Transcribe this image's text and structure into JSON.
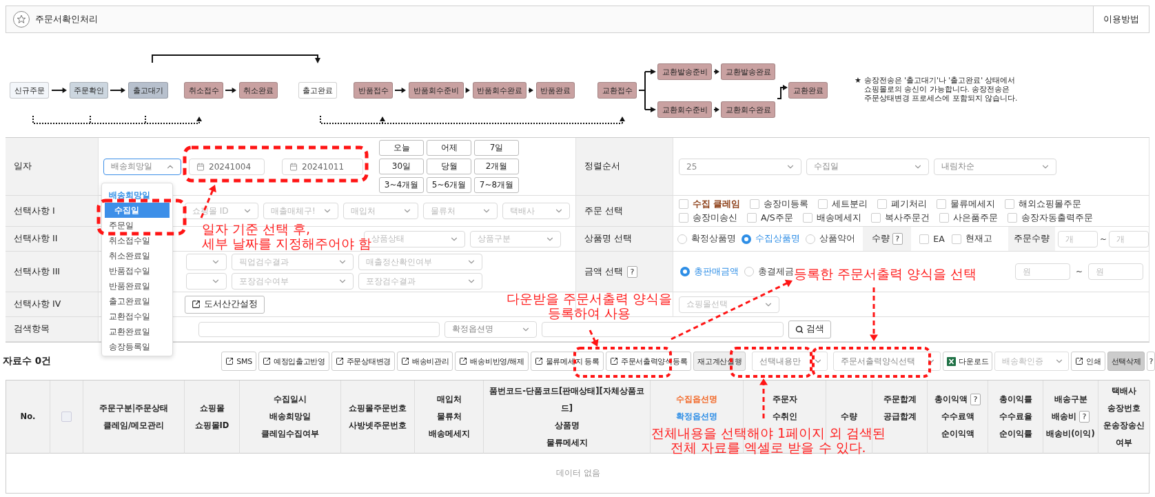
{
  "header": {
    "title": "주문서확인처리",
    "help_button": "이용방법"
  },
  "flow": {
    "nodes": [
      {
        "label": "신규주문",
        "color": "#f3f6fa"
      },
      {
        "label": "주문확인",
        "color": "#ccd6df"
      },
      {
        "label": "출고대기",
        "color": "#b7c0cd"
      },
      {
        "label": "취소접수",
        "color": "#c9a1a1"
      },
      {
        "label": "취소완료",
        "color": "#c9a1a1"
      },
      {
        "label": "출고완료",
        "color": "#ffffff"
      },
      {
        "label": "반품접수",
        "color": "#c9a1a1"
      },
      {
        "label": "반품회수준비",
        "color": "#c9a1a1"
      },
      {
        "label": "반품회수완료",
        "color": "#c9a1a1"
      },
      {
        "label": "반품완료",
        "color": "#c9a1a1"
      },
      {
        "label": "교환접수",
        "color": "#c9a1a1"
      },
      {
        "label": "교환발송준비",
        "color": "#c9a1a1"
      },
      {
        "label": "교환발송완료",
        "color": "#c9a1a1"
      },
      {
        "label": "교환회수준비",
        "color": "#c9a1a1"
      },
      {
        "label": "교환회수완료",
        "color": "#c9a1a1"
      },
      {
        "label": "교환완료",
        "color": "#c9a1a1"
      }
    ],
    "note_mark": "★",
    "note": "송장전송은 '출고대기'나 '출고완료' 상태에서\n쇼핑몰로의 송신이 가능합니다. 송장전송은\n주문상태변경 프로세스에 포함되지 않습니다."
  },
  "form": {
    "date": {
      "label": "일자",
      "basis": "배송희망일",
      "from": "20241004",
      "to": "20241011",
      "quick": [
        "오늘",
        "어제",
        "7일",
        "30일",
        "당월",
        "2개월",
        "3~4개월",
        "5~6개월",
        "7~8개월"
      ]
    },
    "sort": {
      "label": "정렬순서",
      "selects": [
        "25",
        "수집일",
        "내림차순"
      ]
    },
    "option1": {
      "label": "선택사항 I",
      "selects": [
        "쇼핑몰 ID",
        "매출매체구!",
        "매입처",
        "물류처",
        "택배사"
      ]
    },
    "order_select": {
      "label": "주문 선택",
      "options": [
        {
          "label": "수집 클레임",
          "checked": false,
          "kind": "claim"
        },
        {
          "label": "송장미등록",
          "checked": false,
          "kind": "plain"
        },
        {
          "label": "세트분리",
          "checked": false,
          "kind": "plain"
        },
        {
          "label": "폐기처리",
          "checked": false,
          "kind": "plain"
        },
        {
          "label": "물류메세지",
          "checked": false,
          "kind": "plain"
        },
        {
          "label": "해외쇼핑몰주문",
          "checked": false,
          "kind": "plain"
        },
        {
          "label": "송장미송신",
          "checked": false,
          "kind": "plain"
        },
        {
          "label": "A/S주문",
          "checked": false,
          "kind": "plain"
        },
        {
          "label": "배송메세지",
          "checked": false,
          "kind": "plain"
        },
        {
          "label": "복사주문건",
          "checked": false,
          "kind": "plain"
        },
        {
          "label": "사은품주문",
          "checked": false,
          "kind": "plain"
        },
        {
          "label": "송장자동출력주문",
          "checked": false,
          "kind": "plain"
        }
      ]
    },
    "option2": {
      "label": "선택사항 II",
      "selects": [
        "상품상태",
        "상품구분"
      ]
    },
    "product_name": {
      "label": "상품명 선택",
      "options": [
        {
          "label": "확정상품명",
          "selected": false
        },
        {
          "label": "수집상품명",
          "selected": true
        },
        {
          "label": "상품약어",
          "selected": false
        }
      ],
      "qty_label": "수량",
      "qty_help": "?",
      "checks": [
        {
          "label": "EA",
          "checked": false
        },
        {
          "label": "현재고",
          "checked": false
        }
      ],
      "order_qty_label": "주문수량",
      "from_placeholder": "개",
      "tilde": "~",
      "to_placeholder": "개"
    },
    "option3": {
      "label": "선택사항 III",
      "row1": [
        "픽업검수결과",
        "매출정산확인여부"
      ],
      "row2": [
        "포장검수여부",
        "포장검수결과"
      ]
    },
    "amount": {
      "label": "금액 선택",
      "help": "?",
      "options": [
        {
          "label": "총판매금액",
          "selected": true
        },
        {
          "label": "총결제금",
          "selected": false
        }
      ],
      "from_placeholder": "원",
      "tilde": "~",
      "to_placeholder": "원"
    },
    "option4": {
      "label": "선택사항 IV",
      "button": "도서산간설정",
      "mall_select": "쇼핑몰선택"
    },
    "search": {
      "label": "검색항목",
      "field_select": "확정옵션명",
      "button": "검색"
    }
  },
  "dropdown": {
    "items": [
      {
        "label": "배송희망일",
        "current": true,
        "selected": false
      },
      {
        "label": "수집일",
        "current": false,
        "selected": true
      },
      {
        "label": "주문일",
        "current": false,
        "selected": false
      },
      {
        "label": "취소접수일",
        "current": false,
        "selected": false
      },
      {
        "label": "취소완료일",
        "current": false,
        "selected": false
      },
      {
        "label": "반품접수일",
        "current": false,
        "selected": false
      },
      {
        "label": "반품완료일",
        "current": false,
        "selected": false
      },
      {
        "label": "출고완료일",
        "current": false,
        "selected": false
      },
      {
        "label": "교환접수일",
        "current": false,
        "selected": false
      },
      {
        "label": "교환완료일",
        "current": false,
        "selected": false
      },
      {
        "label": "송장등록일",
        "current": false,
        "selected": false
      }
    ]
  },
  "toolbar": {
    "count": "자료수 0건",
    "controls": [
      {
        "label": "SMS",
        "kind": "link"
      },
      {
        "label": "예정입출고반영",
        "kind": "link"
      },
      {
        "label": "주문상태변경",
        "kind": "link"
      },
      {
        "label": "배송비관리",
        "kind": "link"
      },
      {
        "label": "배송비반영/해제",
        "kind": "link"
      },
      {
        "label": "물류메세지 등록",
        "kind": "link"
      },
      {
        "label": "주문서출력양식등록",
        "kind": "link"
      },
      {
        "label": "재고계산실행",
        "kind": "gray"
      },
      {
        "label": "선택내용만",
        "kind": "select"
      },
      {
        "label": "주문서출력양식선택",
        "kind": "select"
      },
      {
        "label": "다운로드",
        "kind": "excel"
      },
      {
        "label": "배송확인증",
        "kind": "disabled_select"
      },
      {
        "label": "인쇄",
        "kind": "link"
      },
      {
        "label": "선택삭제",
        "kind": "dark"
      },
      {
        "label": "?",
        "kind": "help"
      }
    ]
  },
  "table": {
    "columns": [
      {
        "kind": "text",
        "lines": [
          {
            "text": "No."
          }
        ]
      },
      {
        "kind": "checkbox",
        "checked": false
      },
      {
        "kind": "text",
        "lines": [
          {
            "text": "주문구분|주문상태"
          },
          {
            "text": "클레임/메모관리"
          }
        ]
      },
      {
        "kind": "text",
        "lines": [
          {
            "text": "쇼핑몰"
          },
          {
            "text": "쇼핑몰ID"
          }
        ]
      },
      {
        "kind": "text",
        "lines": [
          {
            "text": "수집일시"
          },
          {
            "text": "배송희망일"
          },
          {
            "text": "클레임수집여부"
          }
        ]
      },
      {
        "kind": "text",
        "lines": [
          {
            "text": "쇼핑몰주문번호"
          },
          {
            "text": "사방넷주문번호"
          }
        ]
      },
      {
        "kind": "text",
        "lines": [
          {
            "text": "매입처"
          },
          {
            "text": "물류처"
          },
          {
            "text": "배송메세지"
          }
        ]
      },
      {
        "kind": "text",
        "lines": [
          {
            "text": "품번코드-단품코드[판매상태][자체상품코드]"
          },
          {
            "text": "상품명"
          },
          {
            "text": "물류메세지"
          }
        ]
      },
      {
        "kind": "covered",
        "lines": [
          {
            "text": "수집옵션명",
            "color": "#f26a2a"
          },
          {
            "text": "확정옵션명",
            "color": "#2e8ee6"
          }
        ]
      },
      {
        "kind": "covered",
        "lines": [
          {
            "text": "주문자"
          },
          {
            "text": "수취인"
          }
        ]
      },
      {
        "kind": "text",
        "lines": [
          {
            "text": "수량"
          }
        ]
      },
      {
        "kind": "covered",
        "lines": [
          {
            "text": "주문합계"
          },
          {
            "text": "공급합계"
          }
        ]
      },
      {
        "kind": "text",
        "lines": [
          {
            "text": "총이익액",
            "help": "?"
          },
          {
            "text": "수수료액"
          },
          {
            "text": "순이익액"
          }
        ]
      },
      {
        "kind": "text",
        "lines": [
          {
            "text": "총이익률"
          },
          {
            "text": "수수료율"
          },
          {
            "text": "순이익률"
          }
        ]
      },
      {
        "kind": "text",
        "lines": [
          {
            "text": "배송구분"
          },
          {
            "text": "배송비",
            "help": "?"
          },
          {
            "text": "배송비(이익)"
          }
        ]
      },
      {
        "kind": "text",
        "lines": [
          {
            "text": "택배사"
          },
          {
            "text": "송장번호"
          },
          {
            "text": "운송장송신여부"
          }
        ]
      }
    ],
    "empty": "데이터 없음"
  },
  "annotations": {
    "date_note": "일자 기준 선택 후,\n세부 날짜를 지정해주어야 함",
    "register_note": "다운받을 주문서출력 양식을\n등록하여 사용",
    "select_note": "등록한 주문서출력 양식을 선택",
    "excel_note": "전체내용을 선택해야 1페이지 외 검색된\n전체 자료를 엑셀로 받을 수 있다."
  }
}
